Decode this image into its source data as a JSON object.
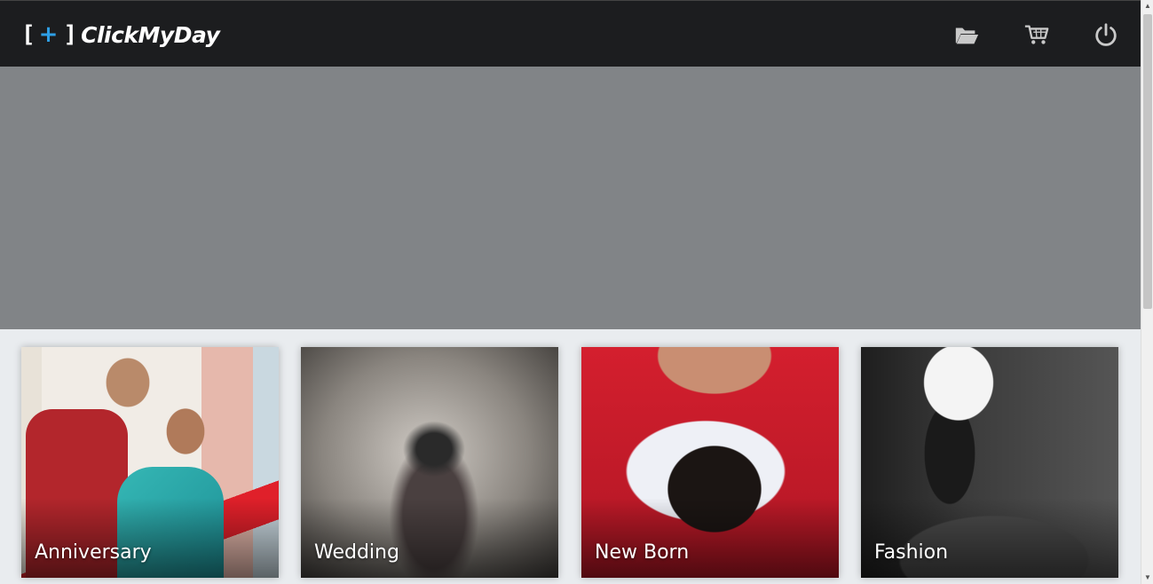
{
  "brand": {
    "open_bracket": "[",
    "plus": "+",
    "close_bracket": "]",
    "name": "ClickMyDay"
  },
  "nav_icons": [
    {
      "name": "folder-open-icon"
    },
    {
      "name": "cart-icon"
    },
    {
      "name": "power-icon"
    }
  ],
  "categories": [
    {
      "label": "Anniversary"
    },
    {
      "label": "Wedding"
    },
    {
      "label": "New Born"
    },
    {
      "label": "Fashion"
    }
  ],
  "colors": {
    "navbar": "#1c1d1f",
    "hero": "#818487",
    "accent": "#2e9fe6",
    "icon": "#c9c9c9"
  }
}
